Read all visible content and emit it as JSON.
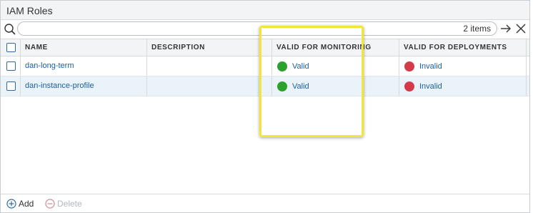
{
  "panel": {
    "title": "IAM Roles"
  },
  "search": {
    "placeholder": "",
    "value": "",
    "items_count": "2 items"
  },
  "table": {
    "columns": [
      "NAME",
      "DESCRIPTION",
      "VALID FOR MONITORING",
      "VALID FOR DEPLOYMENTS"
    ],
    "rows": [
      {
        "name": "dan-long-term",
        "description": "",
        "monitoring": "Valid",
        "deployments": "Invalid"
      },
      {
        "name": "dan-instance-profile",
        "description": "",
        "monitoring": "Valid",
        "deployments": "Invalid"
      }
    ]
  },
  "status_colors": {
    "valid": "#2ea02e",
    "invalid": "#d43a47"
  },
  "highlight_color": "#f2e63a",
  "footer": {
    "add_label": "Add",
    "delete_label": "Delete"
  }
}
